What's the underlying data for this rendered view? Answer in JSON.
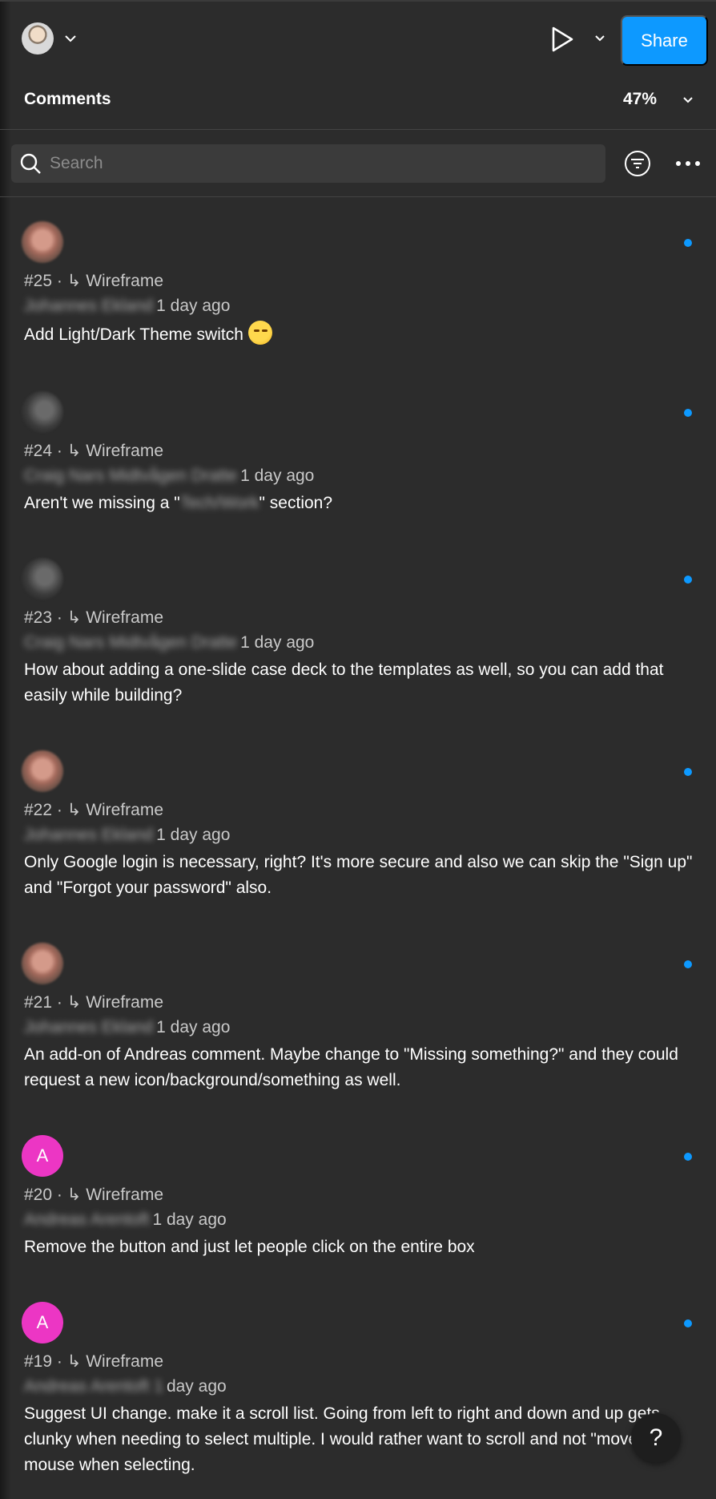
{
  "topbar": {
    "share_label": "Share",
    "icons": {
      "user_avatar": "user-avatar",
      "play": "play-icon",
      "chevron": "chevron-down-icon"
    }
  },
  "comments_panel": {
    "title": "Comments",
    "zoom": "47%",
    "search_placeholder": "Search"
  },
  "comments": [
    {
      "number": "#25",
      "separator": "·",
      "arrow": "↳",
      "page": "Wireframe",
      "author": "Johannes Ekland",
      "time": "1 day ago",
      "text": "Add Light/Dark Theme switch",
      "emoji": "smirk-emoji",
      "avatar": "photo",
      "unread": true
    },
    {
      "number": "#24",
      "separator": "·",
      "arrow": "↳",
      "page": "Wireframe",
      "author": "Craig Nars Midtvågen Dratte",
      "time": "1 day ago",
      "text_before": "Aren't we missing a \"",
      "text_redacted": "Tech/Work",
      "text_after": "\" section?",
      "avatar": "photo-dark",
      "unread": true
    },
    {
      "number": "#23",
      "separator": "·",
      "arrow": "↳",
      "page": "Wireframe",
      "author": "Craig Nars Midtvågen Dratte",
      "time": "1 day ago",
      "text": "How about adding a one-slide case deck to the templates as well, so you can add that easily while building?",
      "avatar": "photo-dark",
      "unread": true
    },
    {
      "number": "#22",
      "separator": "·",
      "arrow": "↳",
      "page": "Wireframe",
      "author": "Johannes Ekland",
      "time": "1 day ago",
      "text": "Only Google login is necessary, right? It's more secure and also we can skip the \"Sign up\" and \"Forgot your password\" also.",
      "avatar": "photo",
      "unread": true
    },
    {
      "number": "#21",
      "separator": "·",
      "arrow": "↳",
      "page": "Wireframe",
      "author": "Johannes Ekland",
      "time": "1 day ago",
      "text": "An add-on of Andreas comment. Maybe change to \"Missing something?\" and they could request a new icon/background/something as well.",
      "avatar": "photo",
      "unread": true
    },
    {
      "number": "#20",
      "separator": "·",
      "arrow": "↳",
      "page": "Wireframe",
      "author": "Andreas Arentoft",
      "time": "1 day ago",
      "text": "Remove the button and just let people click on the entire box",
      "avatar_letter": "A",
      "unread": true
    },
    {
      "number": "#19",
      "separator": "·",
      "arrow": "↳",
      "page": "Wireframe",
      "author": "Andreas Arentoft 1",
      "time": "day ago",
      "text": "Suggest UI change. make it a scroll list. Going from left to right and down and up gets clunky when needing to select multiple. I would rather want to scroll and not \"move\" the mouse when selecting.",
      "avatar_letter": "A",
      "unread": true
    }
  ],
  "help_label": "?",
  "colors": {
    "accent": "#0d99ff",
    "avatar_pink": "#ec36c4",
    "background": "#2c2c2c"
  }
}
